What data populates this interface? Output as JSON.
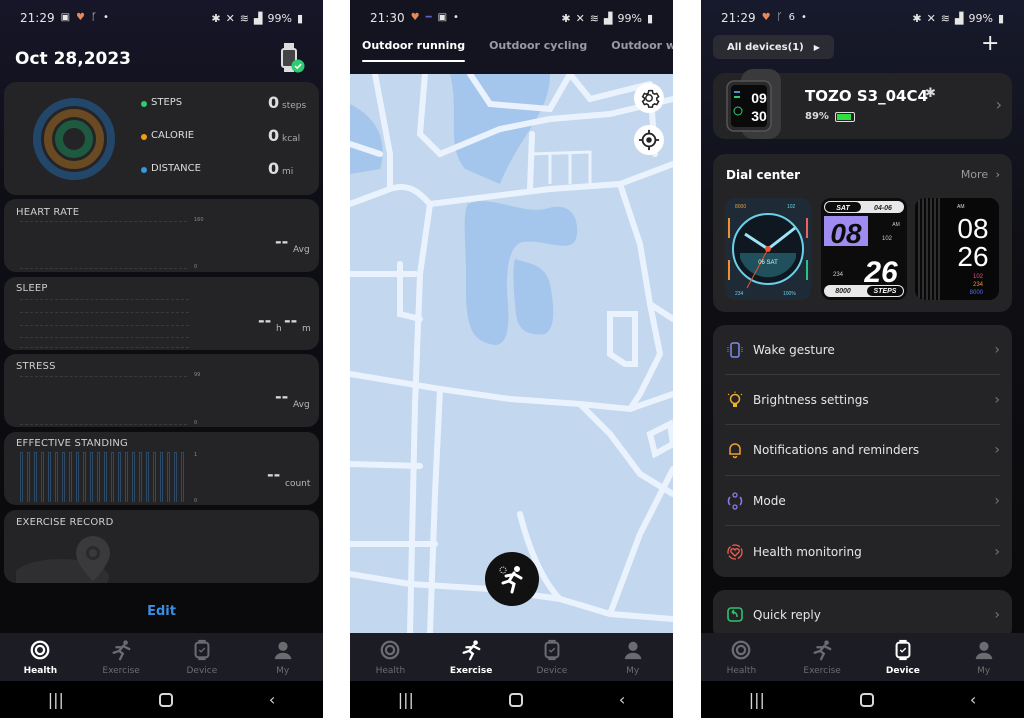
{
  "screens": [
    {
      "status": {
        "time": "21:29",
        "battery": "99%"
      },
      "date": "Oct 28,2023",
      "activity": {
        "metrics": [
          {
            "label": "STEPS",
            "value": "0",
            "unit": "steps",
            "color": "#2ecc71"
          },
          {
            "label": "CALORIE",
            "value": "0",
            "unit": "kcal",
            "color": "#f39c12"
          },
          {
            "label": "DISTANCE",
            "value": "0",
            "unit": "mi",
            "color": "#3498db"
          }
        ]
      },
      "cards": {
        "heart_rate": {
          "title": "HEART RATE",
          "ymax": "160",
          "ymin": "0",
          "value": "--",
          "unit": "Avg"
        },
        "sleep": {
          "title": "SLEEP",
          "hours": "--",
          "h_unit": "h",
          "minutes": "--",
          "m_unit": "m"
        },
        "stress": {
          "title": "STRESS",
          "ymax": "99",
          "ymin": "0",
          "value": "--",
          "unit": "Avg"
        },
        "standing": {
          "title": "EFFECTIVE STANDING",
          "ymax": "1",
          "ymin": "0",
          "value": "--",
          "unit": "count"
        },
        "exercise": {
          "title": "EXERCISE RECORD"
        }
      },
      "edit_label": "Edit"
    },
    {
      "status": {
        "time": "21:30",
        "battery": "99%"
      },
      "tabs": [
        "Outdoor running",
        "Outdoor cycling",
        "Outdoor walking"
      ],
      "active_tab": "Outdoor running"
    },
    {
      "status": {
        "time": "21:29",
        "battery": "99%"
      },
      "devices_button": "All devices(1)",
      "device": {
        "name": "TOZO S3_04C4",
        "battery": "89%",
        "battery_level": 0.89,
        "watch_time_h": "09",
        "watch_time_m": "30"
      },
      "dial_center": {
        "title": "Dial center",
        "more": "More",
        "dials": [
          {
            "name": "analog",
            "date": "06 SAT",
            "steps": "8000",
            "hr": "102",
            "cal": "234",
            "batt": "100%"
          },
          {
            "name": "digital-purple",
            "day": "SAT",
            "date": "04-06",
            "hour": "08",
            "minute": "26",
            "ampm": "AM",
            "hr": "102",
            "cal": "234",
            "steps": "8000",
            "steps_label": "STEPS"
          },
          {
            "name": "digital-mono",
            "ampm": "AM",
            "hour": "08",
            "minute": "26",
            "hr": "102",
            "cal": "234",
            "steps": "8000"
          }
        ]
      },
      "menu": [
        {
          "label": "Wake gesture",
          "icon": "wake-gesture-icon",
          "color": "#7e8cf0"
        },
        {
          "label": "Brightness settings",
          "icon": "bulb-icon",
          "color": "#f0b030"
        },
        {
          "label": "Notifications and reminders",
          "icon": "bell-icon",
          "color": "#f0a030"
        },
        {
          "label": "Mode",
          "icon": "mode-icon",
          "color": "#8a7cf0"
        },
        {
          "label": "Health monitoring",
          "icon": "heart-monitor-icon",
          "color": "#f06050"
        }
      ],
      "quick_reply": "Quick reply"
    }
  ],
  "bottom_nav": [
    "Health",
    "Exercise",
    "Device",
    "My"
  ]
}
